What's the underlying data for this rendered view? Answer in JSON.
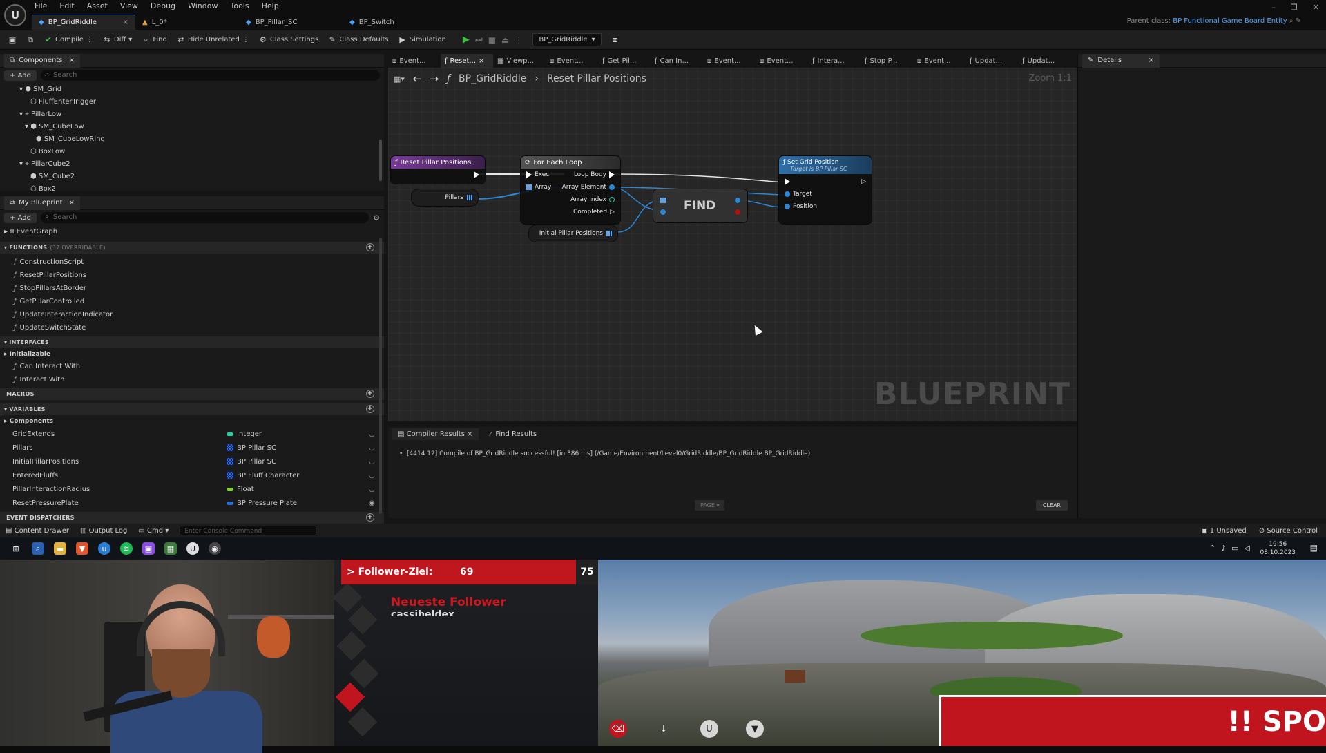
{
  "menu": [
    "File",
    "Edit",
    "Asset",
    "View",
    "Debug",
    "Window",
    "Tools",
    "Help"
  ],
  "doc_tabs": [
    {
      "label": "BP_GridRiddle",
      "active": true
    },
    {
      "label": "L_0*"
    },
    {
      "label": "BP_Pillar_SC"
    },
    {
      "label": "BP_Switch"
    }
  ],
  "parent_class": {
    "label": "Parent class:",
    "value": "BP Functional Game Board Entity"
  },
  "toolbar": {
    "compile": "Compile",
    "diff": "Diff",
    "find": "Find",
    "hide_unrelated": "Hide Unrelated",
    "class_settings": "Class Settings",
    "class_defaults": "Class Defaults",
    "simulation": "Simulation",
    "debug_object": "BP_GridRiddle"
  },
  "components": {
    "tab": "Components",
    "add": "Add",
    "search_placeholder": "Search",
    "tree": [
      "SM_Grid",
      "FluffEnterTrigger",
      "PillarLow",
      "SM_CubeLow",
      "SM_CubeLowRing",
      "BoxLow",
      "PillarCube2",
      "SM_Cube2",
      "Box2"
    ]
  },
  "my_blueprint": {
    "tab": "My Blueprint",
    "add": "Add",
    "search_placeholder": "Search",
    "event_graph": "EventGraph",
    "functions_header": "FUNCTIONS",
    "functions_sub": "(37 OVERRIDABLE)",
    "functions": [
      "ConstructionScript",
      "ResetPillarPositions",
      "StopPillarsAtBorder",
      "GetPillarControlled",
      "UpdateInteractionIndicator",
      "UpdateSwitchState"
    ],
    "interfaces_header": "INTERFACES",
    "interfaces_group": "Initializable",
    "interfaces": [
      "Can Interact With",
      "Interact With"
    ],
    "macros_header": "MACROS",
    "variables_header": "VARIABLES",
    "variables_group": "Components",
    "variables": [
      {
        "name": "GridExtends",
        "type": "Integer",
        "color": "#1fd0a0"
      },
      {
        "name": "Pillars",
        "type": "BP Pillar SC",
        "color": "#2a6fd6"
      },
      {
        "name": "InitialPillarPositions",
        "type": "BP Pillar SC",
        "color": "#2a6fd6"
      },
      {
        "name": "EnteredFluffs",
        "type": "BP Fluff Character",
        "color": "#2a6fd6"
      },
      {
        "name": "PillarInteractionRadius",
        "type": "Float",
        "color": "#7ecf3a"
      },
      {
        "name": "ResetPressurePlate",
        "type": "BP Pressure Plate",
        "color": "#2a6fd6"
      }
    ],
    "dispatchers_header": "EVENT DISPATCHERS"
  },
  "graph_tabs": [
    "Event...",
    "Reset...",
    "Viewp...",
    "Event...",
    "Get Pil...",
    "Can In...",
    "Event...",
    "Event...",
    "Intera...",
    "Stop P...",
    "Event...",
    "Updat...",
    "Updat..."
  ],
  "details_tab": "Details",
  "breadcrumb": {
    "root": "BP_GridRiddle",
    "current": "Reset Pillar Positions"
  },
  "zoom": "Zoom 1:1",
  "watermark": "BLUEPRINT",
  "nodes": {
    "entry": "Reset Pillar Positions",
    "foreach": {
      "title": "For Each Loop",
      "exec": "Exec",
      "array": "Array",
      "loop_body": "Loop Body",
      "element": "Array Element",
      "index": "Array Index",
      "completed": "Completed"
    },
    "find": "FIND",
    "setgrid": {
      "title": "Set Grid Position",
      "subtitle": "Target is BP Pillar SC",
      "target": "Target",
      "position": "Position"
    },
    "var_pillars": "Pillars",
    "var_initial": "Initial Pillar Positions"
  },
  "compiler": {
    "tab": "Compiler Results",
    "find_tab": "Find Results",
    "message": "[4414.12] Compile of BP_GridRiddle successful! [in 386 ms] (/Game/Environment/Level0/GridRiddle/BP_GridRiddle.BP_GridRiddle)",
    "page": "PAGE",
    "clear": "CLEAR"
  },
  "statusbar": {
    "content_drawer": "Content Drawer",
    "output_log": "Output Log",
    "cmd": "Cmd",
    "console_placeholder": "Enter Console Command",
    "unsaved": "1 Unsaved",
    "source_control": "Source Control"
  },
  "taskbar": {
    "time": "19:56",
    "date": "08.10.2023"
  },
  "stream": {
    "follower_label": "> Follower-Ziel:",
    "follower_count": "69",
    "follower_goal": "75",
    "newest_title": "Neueste Follower",
    "newest_name": "cassiheldex",
    "spoiler": "!! SPO"
  }
}
